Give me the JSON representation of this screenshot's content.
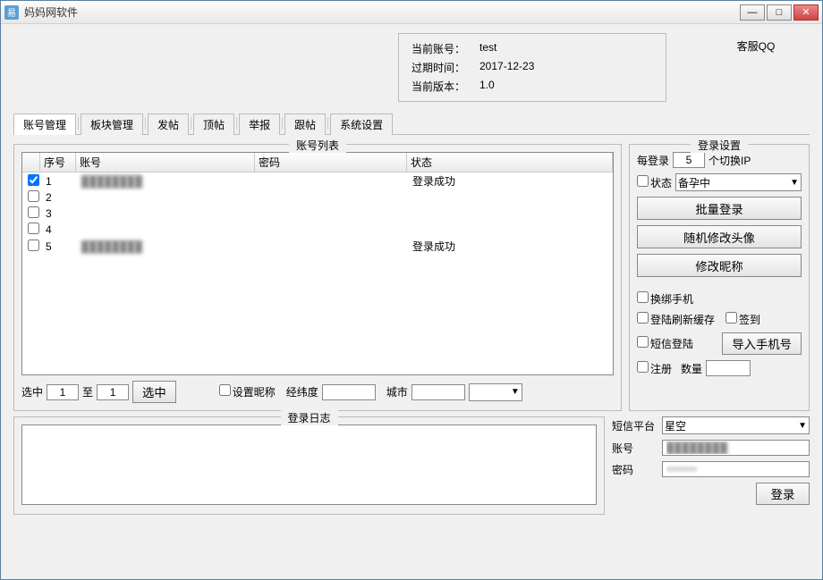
{
  "window": {
    "title": "妈妈网软件"
  },
  "win_controls": {
    "min": "—",
    "max": "□",
    "close": "✕"
  },
  "info": {
    "account_label": "当前账号：",
    "account_value": "test",
    "expire_label": "过期时间：",
    "expire_value": "2017-12-23",
    "version_label": "当前版本：",
    "version_value": "1.0"
  },
  "service_label": "客服QQ",
  "tabs": [
    "账号管理",
    "板块管理",
    "发帖",
    "顶帖",
    "举报",
    "跟帖",
    "系统设置"
  ],
  "active_tab": 0,
  "account_list": {
    "legend": "账号列表",
    "columns": {
      "seq": "序号",
      "account": "账号",
      "password": "密码",
      "status": "状态"
    },
    "rows": [
      {
        "checked": true,
        "seq": "1",
        "account": "████████",
        "status": "登录成功"
      },
      {
        "checked": false,
        "seq": "2",
        "account": "",
        "status": ""
      },
      {
        "checked": false,
        "seq": "3",
        "account": "",
        "status": ""
      },
      {
        "checked": false,
        "seq": "4",
        "account": "",
        "status": ""
      },
      {
        "checked": false,
        "seq": "5",
        "account": "████████",
        "status": "登录成功"
      }
    ]
  },
  "select_row": {
    "label1": "选中",
    "from": "1",
    "label2": "至",
    "to": "1",
    "button": "选中",
    "set_nick": "设置昵称",
    "latlng": "经纬度",
    "latlng_value": "",
    "city_label": "城市",
    "city_value": "",
    "dropdown": ""
  },
  "login_settings": {
    "legend": "登录设置",
    "per_login1": "每登录",
    "per_login_value": "5",
    "per_login2": "个切换IP",
    "status_ck": "状态",
    "status_dropdown": "备孕中",
    "btn_batch": "批量登录",
    "btn_avatar": "随机修改头像",
    "btn_nick": "修改昵称",
    "ck_rebind": "换绑手机",
    "ck_refresh": "登陆刷新缓存",
    "ck_signin": "签到",
    "ck_smslogin": "短信登陆",
    "btn_import": "导入手机号",
    "ck_register": "注册",
    "qty_label": "数量",
    "qty_value": ""
  },
  "log": {
    "legend": "登录日志",
    "content": ""
  },
  "sms": {
    "platform_label": "短信平台",
    "platform_value": "星空",
    "account_label": "账号",
    "account_value": "████████",
    "password_label": "密码",
    "password_value": "████████",
    "login_btn": "登录"
  }
}
